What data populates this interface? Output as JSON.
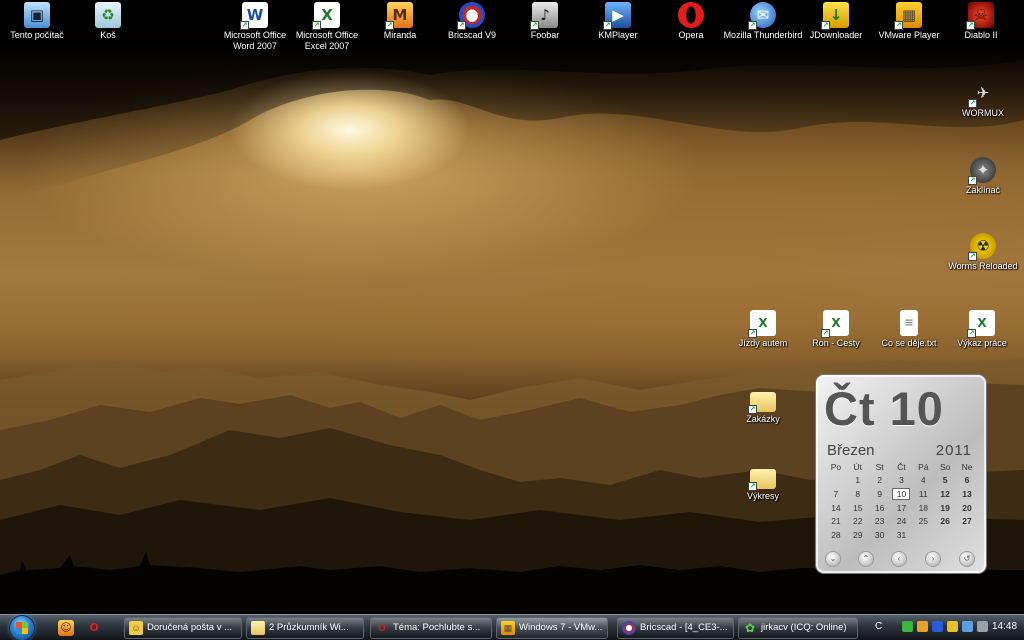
{
  "desktop": {
    "icons_top": [
      {
        "label": "Tento počítač",
        "icon": "computer-icon"
      },
      {
        "label": "Koš",
        "icon": "recycle-bin-icon"
      },
      {
        "label": "Microsoft Office Word 2007",
        "icon": "word-icon"
      },
      {
        "label": "Microsoft Office Excel 2007",
        "icon": "excel-icon"
      },
      {
        "label": "Miranda",
        "icon": "miranda-icon"
      },
      {
        "label": "Bricscad V9",
        "icon": "bricscad-icon"
      },
      {
        "label": "Foobar",
        "icon": "foobar-icon"
      },
      {
        "label": "KMPlayer",
        "icon": "kmplayer-icon"
      },
      {
        "label": "Opera",
        "icon": "opera-icon"
      },
      {
        "label": "Mozilla Thunderbird",
        "icon": "thunderbird-icon"
      },
      {
        "label": "JDownloader",
        "icon": "jdownloader-icon"
      },
      {
        "label": "VMware Player",
        "icon": "vmware-icon"
      },
      {
        "label": "Diablo II",
        "icon": "diablo-icon"
      }
    ],
    "icons_right": [
      {
        "label": "WORMUX",
        "icon": "wormux-icon"
      },
      {
        "label": "Zaklínač",
        "icon": "witcher-icon"
      },
      {
        "label": "Worms Reloaded",
        "icon": "worms-icon"
      }
    ],
    "icons_files": [
      {
        "label": "Jízdy autem",
        "icon": "excel-file-icon"
      },
      {
        "label": "Ron - Cesty",
        "icon": "excel-file-icon"
      },
      {
        "label": "Co se děje.txt",
        "icon": "text-file-icon"
      },
      {
        "label": "Výkaz práce",
        "icon": "excel-file-icon"
      }
    ],
    "icons_folders": [
      {
        "label": "Zakázky",
        "icon": "folder-icon"
      },
      {
        "label": "Výkresy",
        "icon": "folder-icon"
      }
    ]
  },
  "calendar": {
    "day_big": "Čt 10",
    "month": "Březen",
    "year": "2011",
    "weekdays": [
      "Po",
      "Út",
      "St",
      "Čt",
      "Pá",
      "So",
      "Ne"
    ],
    "weeks": [
      [
        "",
        "",
        "1",
        "2",
        "3",
        "4",
        "5",
        "6"
      ],
      [
        "",
        "7",
        "8",
        "9",
        "10",
        "11",
        "12",
        "13"
      ],
      [
        "",
        "14",
        "15",
        "16",
        "17",
        "18",
        "19",
        "20"
      ],
      [
        "",
        "21",
        "22",
        "23",
        "24",
        "25",
        "26",
        "27"
      ],
      [
        "",
        "28",
        "29",
        "30",
        "31",
        "",
        "",
        ""
      ]
    ],
    "today": "10"
  },
  "taskbar": {
    "tasks": [
      {
        "label": "Doručená pošta v ...",
        "icon": "thunderbird-icon"
      },
      {
        "label": "2 Průzkumník Wi...",
        "icon": "folder-icon"
      },
      {
        "label": "Téma: Pochlubte s...",
        "icon": "opera-icon"
      },
      {
        "label": "Windows 7 - VMw...",
        "icon": "vmware-icon"
      },
      {
        "label": "Bricscad - [4_CE3-...",
        "icon": "bricscad-icon"
      },
      {
        "label": "jirkacv (ICQ: Online)",
        "icon": "icq-icon"
      }
    ],
    "tray_lang": "C",
    "clock": "14:48"
  }
}
